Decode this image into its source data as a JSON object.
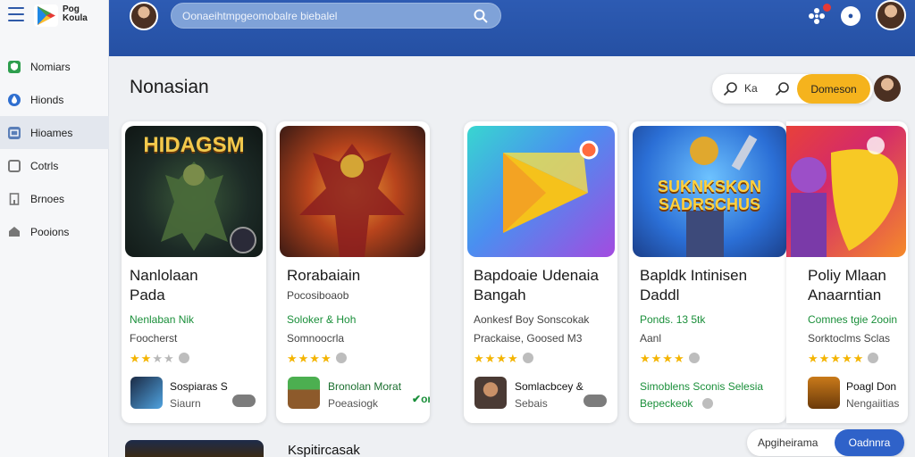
{
  "app": {
    "logo_text": "Pog Koula"
  },
  "sidebar": {
    "items": [
      {
        "label": "Nomiars",
        "icon": "shield-icon",
        "color": "#2e9e4e",
        "active": false
      },
      {
        "label": "Hionds",
        "icon": "droplet-icon",
        "color": "#2f6fd0",
        "active": false
      },
      {
        "label": "Hioames",
        "icon": "folder-icon",
        "color": "#5b7fb8",
        "active": true
      },
      {
        "label": "Cotrls",
        "icon": "window-icon",
        "color": "#777777",
        "active": false
      },
      {
        "label": "Brnoes",
        "icon": "building-icon",
        "color": "#777777",
        "active": false
      },
      {
        "label": "Pooions",
        "icon": "home-icon",
        "color": "#777777",
        "active": false
      }
    ]
  },
  "header": {
    "search_placeholder": "Oonaeihtmpgeomobalre biebalel",
    "notification_count": ""
  },
  "section": {
    "title": "Nonasian",
    "toolbar_label": "Ka",
    "toolbar_button": "Domeson"
  },
  "cards": [
    {
      "image_text": "HIDAGSM",
      "title_line1": "Nanlolaan",
      "title_line2": "Pada",
      "developer": "Nenlaban Nik",
      "subtitle": "Foocherst",
      "rating": 2.5,
      "mini_title": "Sospiaras S",
      "mini_sub": "Siaurn",
      "mini_sub_green": false,
      "mini_badge": ""
    },
    {
      "image_text": "",
      "title_line1": "Rorabaiain",
      "title_line2": "",
      "developer": "Soloker & Hoh",
      "subtitle": "Somnoocrla",
      "rating": 3.5,
      "mini_title": "Bronolan Morat",
      "mini_sub": "Poeasiogk",
      "mini_sub_green": false,
      "mini_badge": "on",
      "subtitle_top": "Pocosiboaob"
    },
    {
      "image_text": "",
      "title_line1": "Bapdoaie Udenaia",
      "title_line2": "Bangah",
      "developer": "Aonkesf Boy Sonscokak",
      "subtitle": "Prackaise, Goosed M3",
      "rating": 4,
      "mini_title": "Somlacbcey &",
      "mini_sub": "Sebais",
      "mini_sub_green": false,
      "mini_badge": ""
    },
    {
      "image_text": "SUKNKSKON SADRSCHUS",
      "title_line1": "Bapldk Intinisen",
      "title_line2": "Daddl",
      "developer": "Ponds. 13 5tk",
      "subtitle": "Aanl",
      "rating": 4,
      "mini_title": "Simoblens Sconis Selesia",
      "mini_sub": "Bepeckeok",
      "mini_sub_green": true,
      "mini_badge": ""
    },
    {
      "image_text": "",
      "title_line1": "Poliy Mlaan",
      "title_line2": "Anaarntian",
      "developer": "Comnes tgie 2ooin",
      "subtitle": "Sorktoclms Sclas",
      "rating": 4.5,
      "mini_title": "Poagl Don",
      "mini_sub": "Nengaiitias",
      "mini_sub_green": false,
      "mini_badge": ""
    }
  ],
  "bottom": {
    "title": "Kspitircasak",
    "bar_label": "Apgiheirama",
    "bar_button": "Oadnnra"
  }
}
